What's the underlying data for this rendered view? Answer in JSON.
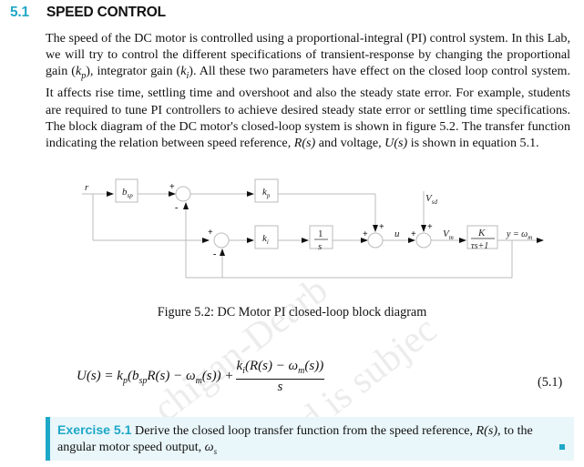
{
  "section": {
    "number": "5.1",
    "title": "SPEED CONTROL"
  },
  "paragraph": {
    "p1": "The speed of the DC motor is controlled using a proportional-integral (PI) control system. In this Lab, we will try to control the different specifications of transient-response by changing the proportional gain (",
    "kp": "kp",
    "p2": "), integrator gain (",
    "ki": "ki",
    "p3": "). All these two parameters have effect on the closed loop control system. It affects rise time, settling time and overshoot and also the steady state error. For example, students are required to tune PI controllers to achieve desired steady state error or settling time specifications. The block diagram of the DC motor's closed-loop system is shown in figure 5.2. The transfer function indicating the relation between speed reference, ",
    "Rs": "R(s)",
    "p4": " and voltage, ",
    "Us": "U(s)",
    "p5": " is shown in equation 5.1."
  },
  "diagram": {
    "input_label": "r",
    "blocks": {
      "bsp": "b",
      "bsp_sub": "sp",
      "kp": "k",
      "kp_sub": "p",
      "ki": "k",
      "ki_sub": "i",
      "integrator_num": "1",
      "integrator_den": "s",
      "plant_num": "K",
      "plant_den": "τs+1"
    },
    "signals": {
      "u": "u",
      "vsd": "V",
      "vsd_sub": "sd",
      "vm": "V",
      "vm_sub": "m",
      "output": "y = ω",
      "output_sub": "m"
    },
    "signs": {
      "plus": "+",
      "minus": "-"
    }
  },
  "figure_caption": "Figure 5.2: DC Motor PI closed-loop block diagram",
  "equation": {
    "lhs": "U(s) = k",
    "lhs_sub_p": "p",
    "mid1": "(b",
    "mid_sub_sp": "sp",
    "mid2": "R(s) − ω",
    "mid_sub_m": "m",
    "mid3": "(s)) +",
    "num1": "k",
    "num_sub_i": "i",
    "num2": "(R(s) − ω",
    "num_sub_m": "m",
    "num3": "(s))",
    "den": "s",
    "number": "(5.1)"
  },
  "exercise": {
    "label": "Exercise 5.1",
    "text1": " Derive the closed loop transfer function from the speed reference, ",
    "Rs": "R(s)",
    "text2": ", to the angular motor speed output, ",
    "omega": "ω",
    "omega_sub": "s"
  },
  "watermark": {
    "line1": "chigan-Dearb",
    "line2": "and is subjec"
  },
  "colors": {
    "accent": "#1ea8c8",
    "exercise_bg": "#e9f6fa"
  }
}
